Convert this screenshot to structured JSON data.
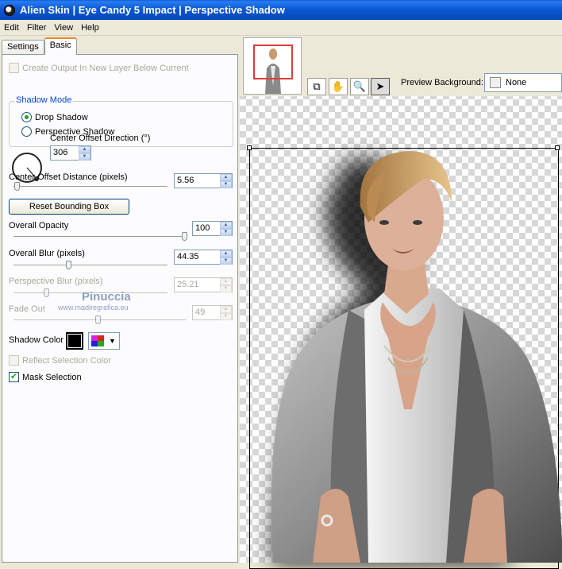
{
  "window": {
    "title": "Alien Skin | Eye Candy 5 Impact | Perspective Shadow"
  },
  "menu": [
    "Edit",
    "Filter",
    "View",
    "Help"
  ],
  "tabs": [
    {
      "label": "Settings"
    },
    {
      "label": "Basic"
    }
  ],
  "basic": {
    "create_output_label": "Create Output In New Layer Below Current",
    "shadow_mode": {
      "label": "Shadow Mode",
      "drop_label": "Drop Shadow",
      "perspective_label": "Perspective Shadow",
      "selected": "Drop Shadow"
    },
    "center_offset_direction": {
      "label": "Center Offset Direction (°)",
      "value": "306"
    },
    "center_offset_distance": {
      "label": "Center Offset Distance (pixels)",
      "value": "5.56"
    },
    "reset_bounding_box_label": "Reset Bounding Box",
    "overall_opacity": {
      "label": "Overall Opacity",
      "value": "100"
    },
    "overall_blur": {
      "label": "Overall Blur (pixels)",
      "value": "44.35"
    },
    "perspective_blur": {
      "label": "Perspective Blur (pixels)",
      "value": "25.21"
    },
    "fade_out": {
      "label": "Fade Out",
      "value": "49"
    },
    "shadow_color": {
      "label": "Shadow Color",
      "value": "#000000"
    },
    "reflect_selection_color_label": "Reflect Selection Color",
    "mask_selection_label": "Mask Selection"
  },
  "watermark": {
    "line1": "Pinuccia",
    "line2": "www.madiregrafica.eu"
  },
  "preview": {
    "background_label": "Preview Background:",
    "background_value": "None"
  },
  "colors": {
    "title_bar": "#0a5ad4",
    "tab_accent": "#e68b2c",
    "group_label": "#0046d5",
    "check_mark": "#21a121"
  }
}
